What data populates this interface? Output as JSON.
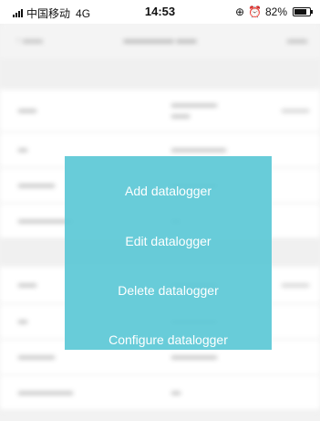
{
  "status_bar": {
    "carrier": "中国移动",
    "network": "4G",
    "time": "14:53",
    "battery": "82%"
  },
  "action_menu": {
    "items": [
      "Add datalogger",
      "Edit datalogger",
      "Delete datalogger",
      "Configure datalogger"
    ]
  },
  "colors": {
    "menu_background": "#5cc8d6",
    "menu_text": "#ffffff"
  }
}
